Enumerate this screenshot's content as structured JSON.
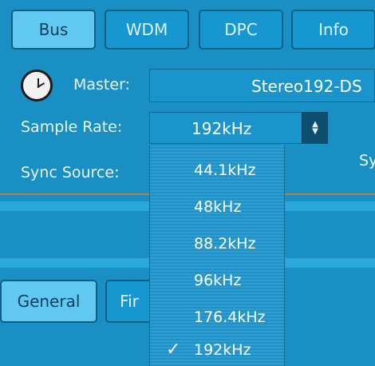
{
  "tabs": [
    {
      "label": "Bus",
      "active": true
    },
    {
      "label": "WDM",
      "active": false
    },
    {
      "label": "DPC",
      "active": false
    },
    {
      "label": "Info",
      "active": false
    }
  ],
  "master": {
    "label": "Master:",
    "value": "Stereo192-DS"
  },
  "sample_rate": {
    "label": "Sample Rate:",
    "value": "192kHz"
  },
  "sync_source": {
    "label": "Sync Source:",
    "partial_right_label": "Sy"
  },
  "dropdown": {
    "options": [
      "44.1kHz",
      "48kHz",
      "88.2kHz",
      "96kHz",
      "176.4kHz",
      "192kHz"
    ],
    "selected": "192kHz",
    "check_glyph": "✓"
  },
  "bottom_buttons": [
    {
      "label": "General"
    },
    {
      "label": "Fir"
    }
  ],
  "icons": {
    "clock": "clock-icon",
    "up_down": "up-down-chevrons-icon"
  },
  "colors": {
    "bg": "#1a8fc4",
    "accent": "#61c8f2",
    "separator": "#c77d45"
  }
}
